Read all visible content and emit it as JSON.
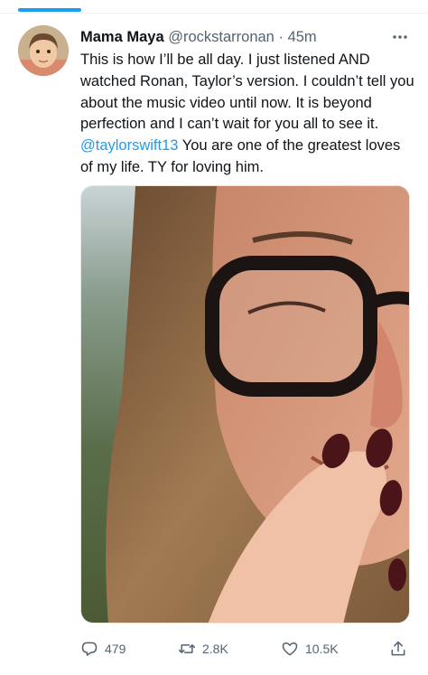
{
  "colors": {
    "accent": "#1d9bf0",
    "text_primary": "#0f1419",
    "text_secondary": "#536471"
  },
  "tweet": {
    "display_name": "Mama Maya",
    "handle": "@rockstarronan",
    "separator": "·",
    "time": "45m",
    "more_icon": "ellipsis-icon",
    "text_before_mention": "This is how I’ll be all day. I just listened AND watched Ronan, Taylor’s version. I couldn’t tell you about the music video until now. It is beyond perfection and I can’t wait for you all to see it.",
    "mention": "@taylorswift13",
    "text_after_mention": "You are one of the greatest loves of my life. TY for loving him."
  },
  "actions": {
    "reply": {
      "icon": "reply-icon",
      "count": "479"
    },
    "retweet": {
      "icon": "retweet-icon",
      "count": "2.8K"
    },
    "like": {
      "icon": "heart-icon",
      "count": "10.5K"
    },
    "share": {
      "icon": "share-icon"
    }
  }
}
